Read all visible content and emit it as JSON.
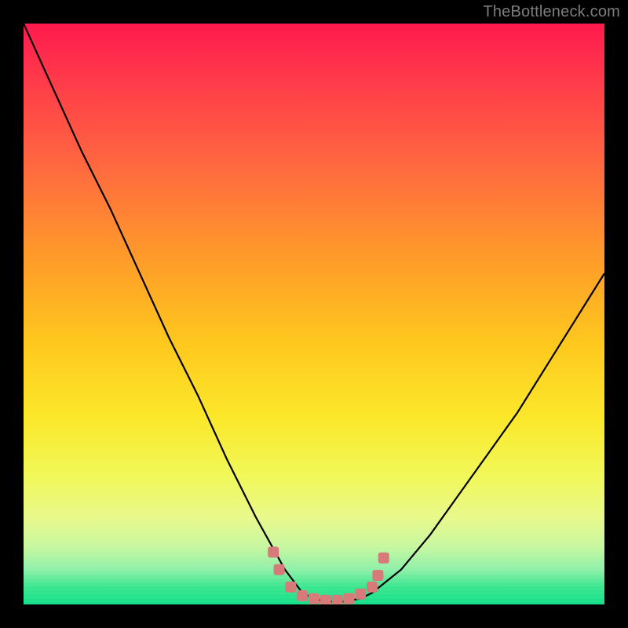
{
  "watermark": "TheBottleneck.com",
  "chart_data": {
    "type": "line",
    "title": "",
    "xlabel": "",
    "ylabel": "",
    "xlim": [
      0,
      100
    ],
    "ylim": [
      0,
      100
    ],
    "grid": false,
    "legend": false,
    "series": [
      {
        "name": "bottleneck-curve",
        "x": [
          0,
          5,
          10,
          15,
          20,
          25,
          30,
          35,
          40,
          45,
          48,
          50,
          52,
          55,
          58,
          60,
          65,
          70,
          75,
          80,
          85,
          90,
          95,
          100
        ],
        "y": [
          100,
          89,
          78,
          68,
          57,
          46,
          36,
          25,
          15,
          6,
          2,
          1,
          0.5,
          0.5,
          1,
          2,
          6,
          12,
          19,
          26,
          33,
          41,
          49,
          57
        ]
      }
    ],
    "markers": {
      "name": "highlight-segment",
      "color": "#d97a7a",
      "x": [
        43,
        44,
        46,
        48,
        50,
        52,
        54,
        56,
        58,
        60,
        61,
        62
      ],
      "y": [
        9,
        6,
        3,
        1.5,
        1,
        0.7,
        0.7,
        1,
        1.8,
        3,
        5,
        8
      ]
    },
    "background_gradient": {
      "top": "#ff1a4d",
      "bottom": "#15df89"
    }
  }
}
